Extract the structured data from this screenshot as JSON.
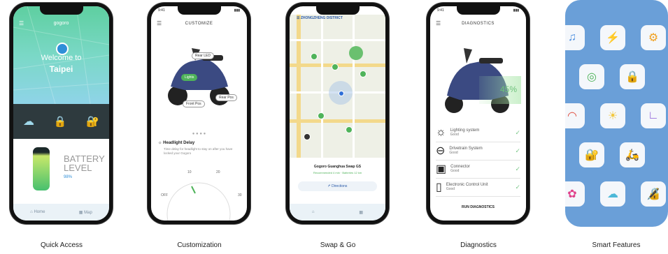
{
  "captions": [
    "Quick Access",
    "Customization",
    "Swap & Go",
    "Diagnostics",
    "Smart Features"
  ],
  "phone1": {
    "brand": "gogoro",
    "welcome": "Welcome to",
    "city": "Taipei",
    "battery_label_line1": "BATTERY",
    "battery_label_line2": "LEVEL",
    "battery_value": "98%",
    "tab_home": "Home",
    "tab_map": "Map"
  },
  "phone2": {
    "title": "CUSTOMIZE",
    "time": "9:41",
    "pills": [
      "Rear LED",
      "Lights",
      "Front Pos",
      "Rear Pos"
    ],
    "setting_title": "Headlight Delay",
    "setting_desc": "Time delay for headlight to stay on after you have locked your Gogoro",
    "dial_labels": [
      "OFF",
      "10",
      "20",
      "30"
    ]
  },
  "phone3": {
    "district": "ZHONGZHENG DISTRICT",
    "station_name": "Gogoro Guanghua Swap GS",
    "station_sub": "Recommended 4 min · Batteries 12 km",
    "directions": "Directions"
  },
  "phone4": {
    "title": "DIAGNOSTICS",
    "time": "9:41",
    "percent": "45%",
    "items": [
      {
        "label": "Lighting system",
        "sub": "Good"
      },
      {
        "label": "Drivetrain System",
        "sub": "Good"
      },
      {
        "label": "Connector",
        "sub": "Good"
      },
      {
        "label": "Electronic Control Unit",
        "sub": "Good"
      }
    ],
    "run_button": "RUN DIAGNOSTICS"
  },
  "phone5": {
    "tiles": [
      "music-icon",
      "power-icon",
      "gear-icon",
      "target-icon",
      "lock-icon",
      "gauge-icon",
      "bulb-icon",
      "chart-icon",
      "lock-alt-icon",
      "scooter-icon",
      "flower-icon",
      "cloud-icon",
      "padlock-icon"
    ]
  },
  "colors": {
    "accent_green": "#4fb35a",
    "smart_bg": "#6a9fd8",
    "diagnostic_green": "#7cc88a"
  }
}
